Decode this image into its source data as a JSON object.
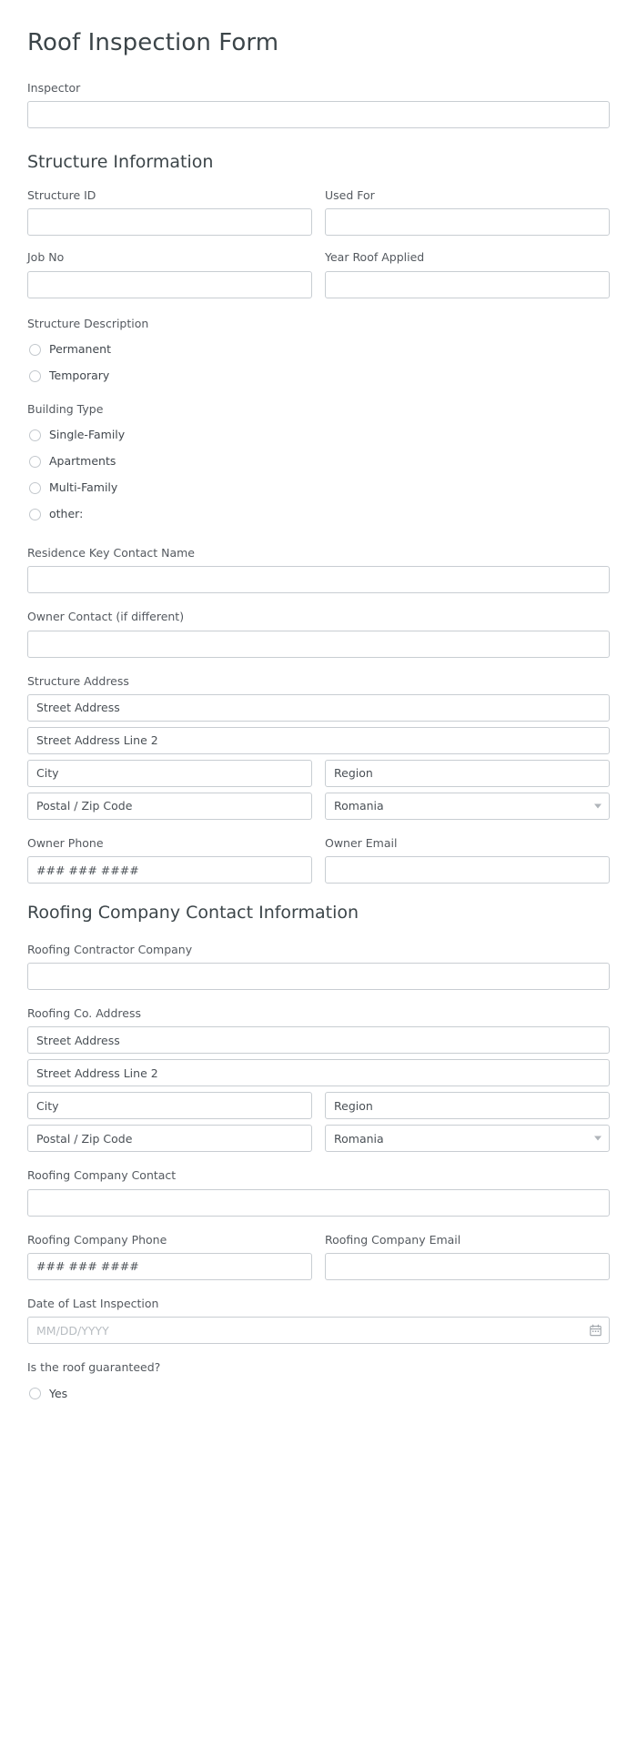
{
  "form": {
    "title": "Roof Inspection Form"
  },
  "inspector": {
    "label": "Inspector",
    "value": "",
    "placeholder": ""
  },
  "structure_section": {
    "heading": "Structure Information",
    "structure_id": {
      "label": "Structure ID",
      "placeholder": ""
    },
    "used_for": {
      "label": "Used For",
      "placeholder": ""
    },
    "job_no": {
      "label": "Job No",
      "placeholder": ""
    },
    "year_roof_applied": {
      "label": "Year Roof Applied",
      "placeholder": ""
    },
    "structure_description": {
      "label": "Structure Description",
      "options": [
        {
          "label": "Permanent",
          "selected": false
        },
        {
          "label": "Temporary",
          "selected": false
        }
      ]
    },
    "building_type": {
      "label": "Building Type",
      "options": [
        {
          "label": "Single-Family",
          "selected": false
        },
        {
          "label": "Apartments",
          "selected": false
        },
        {
          "label": "Multi-Family",
          "selected": false
        },
        {
          "label": "other:",
          "selected": false
        }
      ]
    },
    "residence_key_contact_name": {
      "label": "Residence Key Contact Name",
      "placeholder": ""
    },
    "owner_contact": {
      "label": "Owner Contact (if different)",
      "placeholder": ""
    },
    "structure_address": {
      "label": "Structure Address",
      "street1_placeholder": "Street Address",
      "street2_placeholder": "Street Address Line 2",
      "city_placeholder": "City",
      "region_placeholder": "Region",
      "postal_placeholder": "Postal / Zip Code",
      "country_value": "Romania"
    },
    "owner_phone": {
      "label": "Owner Phone",
      "placeholder": "### ### ####"
    },
    "owner_email": {
      "label": "Owner Email",
      "placeholder": ""
    }
  },
  "roofing_section": {
    "heading": "Roofing Company Contact Information",
    "contractor_company": {
      "label": "Roofing Contractor Company",
      "placeholder": ""
    },
    "roofing_address": {
      "label": "Roofing Co. Address",
      "street1_placeholder": "Street Address",
      "street2_placeholder": "Street Address Line 2",
      "city_placeholder": "City",
      "region_placeholder": "Region",
      "postal_placeholder": "Postal / Zip Code",
      "country_value": "Romania"
    },
    "company_contact": {
      "label": "Roofing Company Contact",
      "placeholder": ""
    },
    "company_phone": {
      "label": "Roofing Company Phone",
      "placeholder": "### ### ####"
    },
    "company_email": {
      "label": "Roofing Company Email",
      "placeholder": ""
    },
    "date_last_inspection": {
      "label": "Date of Last Inspection",
      "placeholder": "MM/DD/YYYY",
      "icon": "calendar-icon"
    },
    "roof_guaranteed": {
      "label": "Is the roof guaranteed?",
      "options": [
        {
          "label": "Yes",
          "selected": false
        }
      ]
    }
  },
  "colors": {
    "border": "#c8cdd2",
    "label_text": "#54595f",
    "heading_text": "#3c4549",
    "placeholder": "#6f767d",
    "placeholder_light": "#b7bcc1",
    "background": "#ffffff"
  }
}
